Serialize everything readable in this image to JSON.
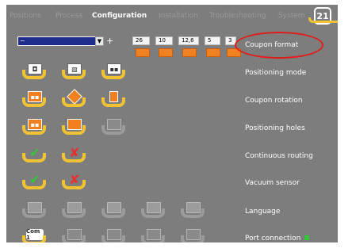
{
  "tabs": [
    "Positions",
    "Process",
    "Configuration",
    "Installation",
    "Troubleshooting",
    "System"
  ],
  "active_tab": "Configuration",
  "logo_text": "21",
  "format": {
    "dropdown_value": "~",
    "add_label": "+",
    "values": [
      "26",
      "10",
      "12,6",
      "5",
      "3"
    ]
  },
  "rows": [
    {
      "label": "Coupon format"
    },
    {
      "label": "Positioning mode"
    },
    {
      "label": "Coupon rotation"
    },
    {
      "label": "Positioning holes"
    },
    {
      "label": "Continuous routing"
    },
    {
      "label": "Vacuum sensor"
    },
    {
      "label": "Language"
    },
    {
      "label": "Port connection",
      "status": "ok"
    }
  ],
  "port_button": "Com 1",
  "colors": {
    "background": "#7d7d7d",
    "accent_yellow": "#f1c232",
    "highlight_red": "#e21b1b",
    "status_green": "#35c43a",
    "icon_orange": "#f08020"
  }
}
